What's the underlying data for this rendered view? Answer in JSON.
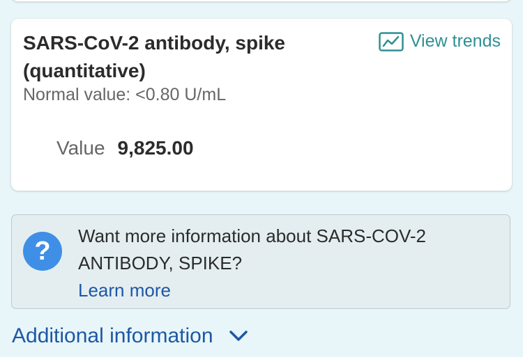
{
  "result_card": {
    "title": "SARS-CoV-2 antibody, spike (quantitative)",
    "view_trends_label": "View trends",
    "normal_value": "Normal value: <0.80 U/mL",
    "value_label": "Value",
    "value": "9,825.00"
  },
  "info_box": {
    "icon": "question-mark-icon",
    "text": "Want more information about SARS-COV-2 ANTIBODY, SPIKE?",
    "link_label": "Learn more"
  },
  "additional_info": {
    "label": "Additional information",
    "icon": "chevron-down-icon"
  },
  "colors": {
    "page_background": "#e8f6f9",
    "trends_accent": "#2f8f93",
    "link_blue": "#1d57a5",
    "help_icon_blue": "#3f8fe6"
  }
}
